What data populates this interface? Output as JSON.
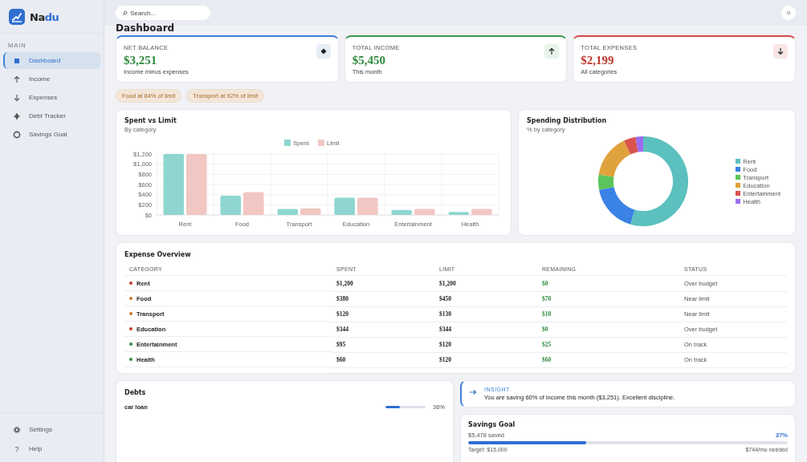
{
  "brand": {
    "text_main": "Na",
    "text_accent": "du"
  },
  "sidebar": {
    "section": "MAIN",
    "items": [
      {
        "label": "Dashboard",
        "selected": true
      },
      {
        "label": "Income",
        "selected": false
      },
      {
        "label": "Expenses",
        "selected": false
      },
      {
        "label": "Debt Tracker",
        "selected": false
      },
      {
        "label": "Savings Goal",
        "selected": false
      }
    ],
    "footer_items": [
      {
        "label": "Settings"
      },
      {
        "label": "Help",
        "glyph": "?"
      }
    ]
  },
  "search": {
    "placeholder": "Search..."
  },
  "page_title": "Dashboard",
  "stats": [
    {
      "kind": "balance",
      "label": "NET BALANCE",
      "value": "$3,251",
      "sub": "Income minus expenses"
    },
    {
      "kind": "income",
      "label": "TOTAL INCOME",
      "value": "$5,450",
      "sub": "This month"
    },
    {
      "kind": "expense",
      "label": "TOTAL EXPENSES",
      "value": "$2,199",
      "sub": "All categories"
    }
  ],
  "alerts": [
    "Food at 84% of limit",
    "Transport at 92% of limit"
  ],
  "spent_chart": {
    "title": "Spent vs Limit",
    "subtitle": "By category",
    "chart_data": {
      "type": "bar",
      "categories": [
        "Rent",
        "Food",
        "Transport",
        "Education",
        "Entertainment",
        "Health"
      ],
      "series": [
        {
          "name": "Spent",
          "color": "#8ed6cf",
          "values": [
            1200,
            380,
            120,
            340,
            100,
            60
          ]
        },
        {
          "name": "Limit",
          "color": "#f2c7c3",
          "values": [
            1200,
            450,
            130,
            340,
            120,
            120
          ]
        }
      ],
      "grid": true,
      "legend": true,
      "ylim": [
        0,
        1200
      ],
      "yticks": [
        {
          "value": 0,
          "label": "$0"
        },
        {
          "value": 200,
          "label": "$200"
        },
        {
          "value": 400,
          "label": "$400"
        },
        {
          "value": 600,
          "label": "$600"
        },
        {
          "value": 800,
          "label": "$800"
        },
        {
          "value": 1000,
          "label": "$1,000"
        },
        {
          "value": 1200,
          "label": "$1,200"
        }
      ]
    }
  },
  "distribution_chart": {
    "title": "Spending Distribution",
    "subtitle": "% by category",
    "chart_data": {
      "type": "donut",
      "categories": [
        "Rent",
        "Food",
        "Transport",
        "Education",
        "Entertainment",
        "Health"
      ],
      "series": [
        {
          "values": [
            54.6,
            17.3,
            5.5,
            15.6,
            4.3,
            2.7
          ]
        }
      ],
      "legend": true,
      "colors": [
        "#5bc0be",
        "#3b82e6",
        "#5bc45b",
        "#e0a23c",
        "#d9534f",
        "#9b6cf0"
      ]
    }
  },
  "expense_table": {
    "title": "Expense Overview",
    "columns": [
      "CATEGORY",
      "SPENT",
      "LIMIT",
      "REMAINING",
      "STATUS"
    ],
    "rows": [
      {
        "category": "Rent",
        "color": "#c0392b",
        "spent": "$1,200",
        "limit": "$1,200",
        "remaining": "$0",
        "status": "Over budget"
      },
      {
        "category": "Food",
        "color": "#c27a2c",
        "spent": "$380",
        "limit": "$450",
        "remaining": "$70",
        "status": "Near limit"
      },
      {
        "category": "Transport",
        "color": "#c27a2c",
        "spent": "$120",
        "limit": "$130",
        "remaining": "$10",
        "status": "Near limit"
      },
      {
        "category": "Education",
        "color": "#c0392b",
        "spent": "$344",
        "limit": "$344",
        "remaining": "$0",
        "status": "Over budget"
      },
      {
        "category": "Entertainment",
        "color": "#2e8b3e",
        "spent": "$95",
        "limit": "$120",
        "remaining": "$25",
        "status": "On track"
      },
      {
        "category": "Health",
        "color": "#2e8b3e",
        "spent": "$60",
        "limit": "$120",
        "remaining": "$60",
        "status": "On track"
      }
    ]
  },
  "debts": {
    "title": "Debts",
    "items": [
      {
        "name": "car loan",
        "level": 0.36,
        "percent": "36%"
      }
    ]
  },
  "insight": {
    "label": "INSIGHT",
    "text": "You are saving 60% of income this month ($3,251). Excellent discipline."
  },
  "savings": {
    "title": "Savings Goal",
    "saved": "$5,478 saved",
    "percent": "37%",
    "level": 0.37,
    "target": "Target: $15,000",
    "needed": "$744/mo needed"
  }
}
